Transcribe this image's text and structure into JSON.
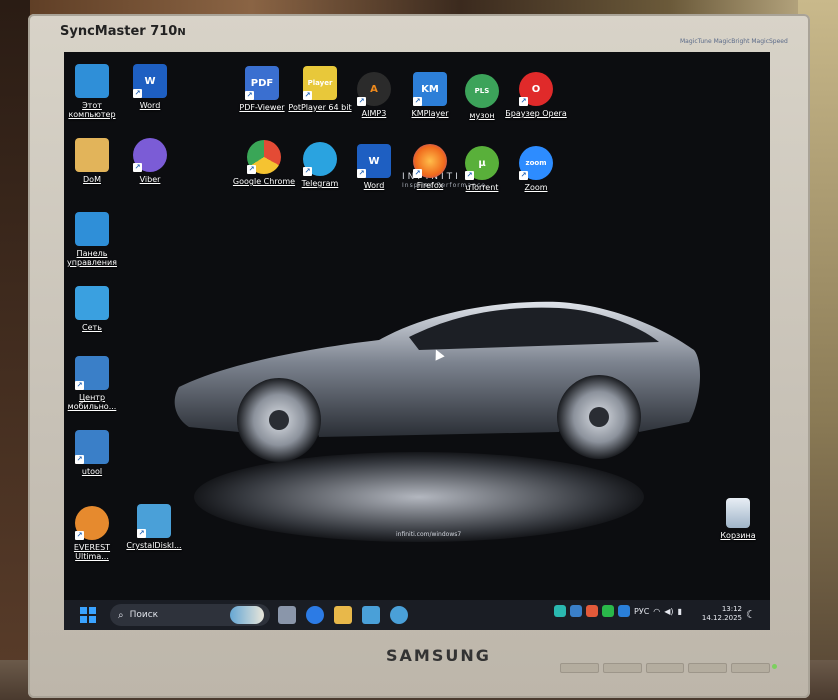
{
  "monitor": {
    "model": "SyncMaster 710",
    "model_suffix": "N",
    "brand": "SAMSUNG",
    "badges": [
      "MagicTune",
      "MagicBright",
      "MagicSpeed"
    ]
  },
  "wallpaper": {
    "brand_text": "INFINITI",
    "tagline": "Inspired Performance",
    "url": "infiniti.com/windows7"
  },
  "desktop_icons": [
    {
      "id": "this-pc",
      "label": "Этот компьютер",
      "color": "#2f8fd8"
    },
    {
      "id": "word-1",
      "label": "Word",
      "color": "#1e5fc2",
      "glyph": "W"
    },
    {
      "id": "dom",
      "label": "DoM",
      "color": "#e2b45a"
    },
    {
      "id": "viber",
      "label": "Viber",
      "color": "#7b5cd6"
    },
    {
      "id": "control-panel",
      "label": "Панель управления",
      "color": "#2f8fd8"
    },
    {
      "id": "network",
      "label": "Сеть",
      "color": "#3aa0e0"
    },
    {
      "id": "mobility",
      "label": "Центр мобильно...",
      "color": "#3a7fc8"
    },
    {
      "id": "utool",
      "label": "utool",
      "color": "#3a7fc8"
    },
    {
      "id": "everest",
      "label": "EVEREST Ultima...",
      "color": "#e68a2e"
    },
    {
      "id": "crystal",
      "label": "CrystalDiskI...",
      "color": "#4aa0d8"
    },
    {
      "id": "pdf-viewer",
      "label": "PDF-Viewer",
      "color": "#3a6fd0",
      "glyph": "PDF"
    },
    {
      "id": "potplayer",
      "label": "PotPlayer 64 bit",
      "color": "#e8c83a",
      "glyph": "Player"
    },
    {
      "id": "aimp",
      "label": "AIMP3",
      "color": "#f08a1c",
      "glyph": "A"
    },
    {
      "id": "kmplayer",
      "label": "KMPlayer",
      "color": "#2d7fd8",
      "glyph": "KM"
    },
    {
      "id": "music",
      "label": "музон",
      "color": "#3ca35a",
      "glyph": "PLS"
    },
    {
      "id": "opera",
      "label": "Браузер Opera",
      "color": "#e02a2a",
      "glyph": "O"
    },
    {
      "id": "chrome",
      "label": "Google Chrome",
      "color": "#e44b35"
    },
    {
      "id": "telegram",
      "label": "Telegram",
      "color": "#2aa3e0"
    },
    {
      "id": "word-2",
      "label": "Word",
      "color": "#1e5fc2",
      "glyph": "W"
    },
    {
      "id": "firefox",
      "label": "Firefox",
      "color": "#f06a1c"
    },
    {
      "id": "utorrent",
      "label": "uTorrent",
      "color": "#59b03a",
      "glyph": "μ"
    },
    {
      "id": "zoom",
      "label": "Zoom",
      "color": "#2d8cff",
      "glyph": "zoom"
    },
    {
      "id": "recycle-bin",
      "label": "Корзина",
      "color": "#4aa0d8"
    }
  ],
  "taskbar": {
    "search_placeholder": "Поиск",
    "apps": [
      {
        "id": "task-view",
        "color": "#8a96aa"
      },
      {
        "id": "meet",
        "color": "#2c7be5"
      },
      {
        "id": "explorer",
        "color": "#e8b84a"
      },
      {
        "id": "store",
        "color": "#4aa0d8"
      },
      {
        "id": "settings",
        "color": "#4aa0d8"
      }
    ],
    "tray": {
      "language": "РУС",
      "time": "13:12",
      "date": "14.12.2025"
    }
  }
}
